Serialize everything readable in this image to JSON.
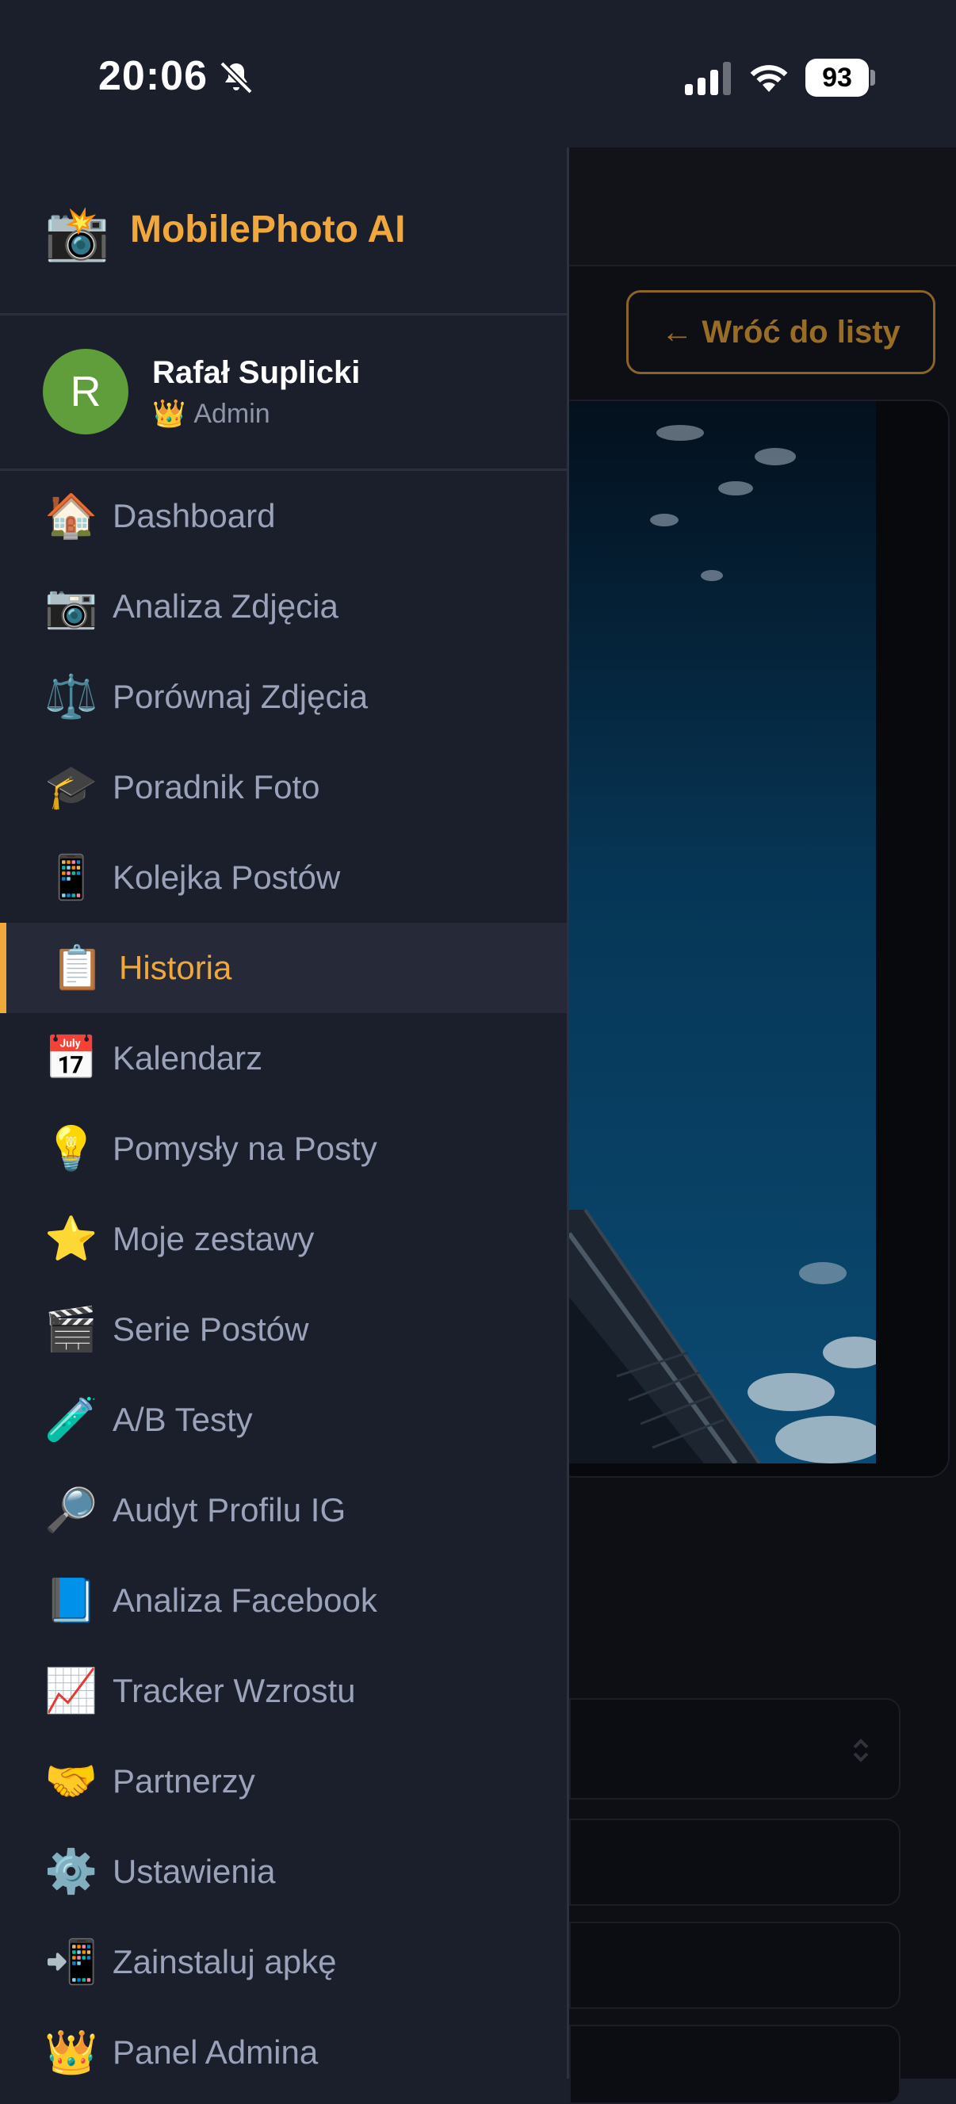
{
  "status_bar": {
    "time": "20:06",
    "battery": "93"
  },
  "background_page": {
    "back_button": "← Wróć do listy"
  },
  "drawer": {
    "brand": {
      "icon": "📸",
      "title": "MobilePhoto AI"
    },
    "user": {
      "initial": "R",
      "name": "Rafał Suplicki",
      "role_icon": "👑",
      "role": "Admin"
    },
    "menu": [
      {
        "icon": "🏠",
        "label": "Dashboard"
      },
      {
        "icon": "📷",
        "label": "Analiza Zdjęcia"
      },
      {
        "icon": "⚖️",
        "label": "Porównaj Zdjęcia"
      },
      {
        "icon": "🎓",
        "label": "Poradnik Foto"
      },
      {
        "icon": "📱",
        "label": "Kolejka Postów"
      },
      {
        "icon": "📋",
        "label": "Historia",
        "active": true
      },
      {
        "icon": "📅",
        "label": "Kalendarz"
      },
      {
        "icon": "💡",
        "label": "Pomysły na Posty"
      },
      {
        "icon": "⭐",
        "label": "Moje zestawy"
      },
      {
        "icon": "🎬",
        "label": "Serie Postów"
      },
      {
        "icon": "🧪",
        "label": "A/B Testy"
      },
      {
        "icon": "🔎",
        "label": "Audyt Profilu IG"
      },
      {
        "icon": "📘",
        "label": "Analiza Facebook"
      },
      {
        "icon": "📈",
        "label": "Tracker Wzrostu"
      },
      {
        "icon": "🤝",
        "label": "Partnerzy"
      },
      {
        "icon": "⚙️",
        "label": "Ustawienia"
      },
      {
        "icon": "📲",
        "label": "Zainstaluj apkę"
      },
      {
        "icon": "👑",
        "label": "Panel Admina"
      }
    ]
  }
}
